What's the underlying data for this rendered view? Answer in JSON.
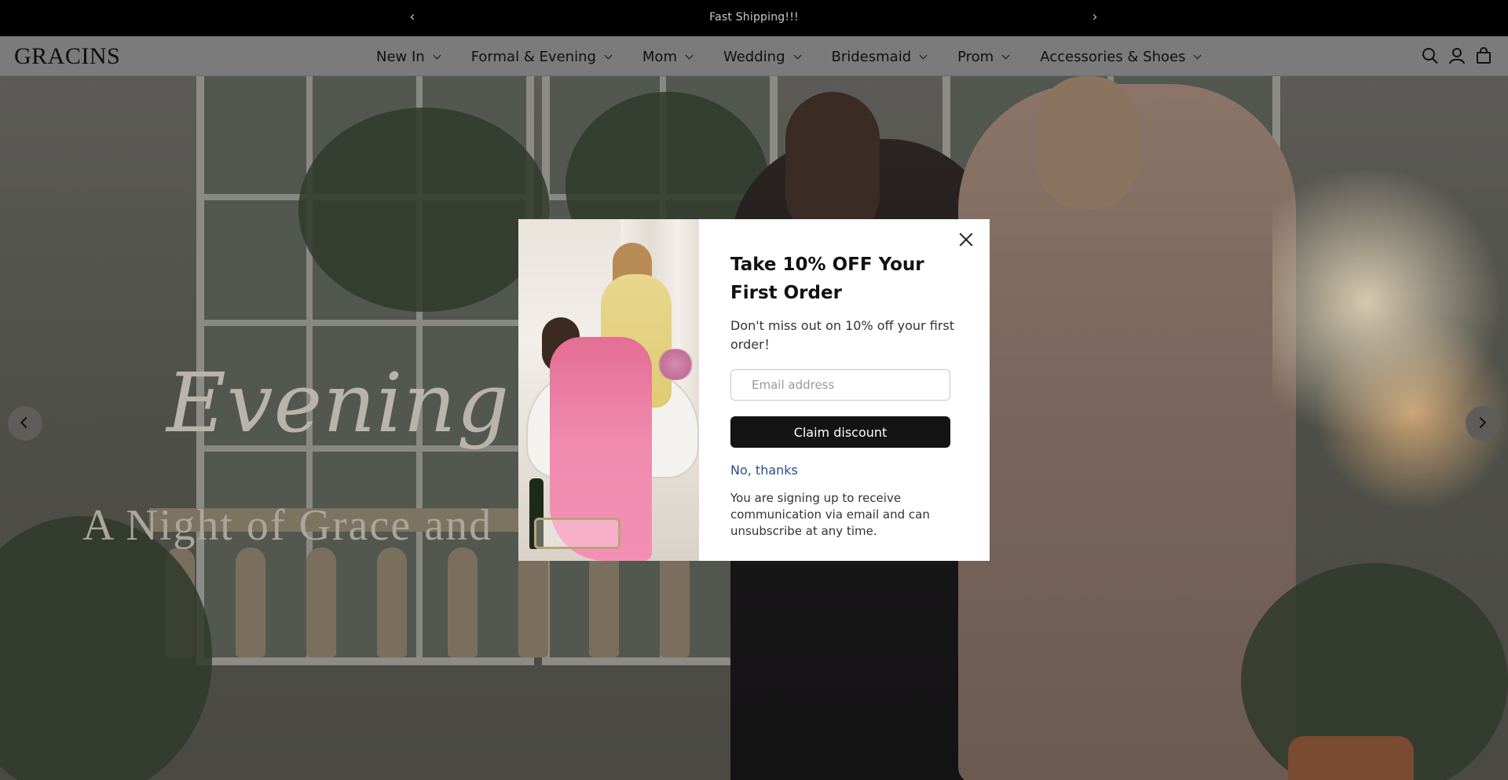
{
  "announcement": {
    "message": "Fast Shipping!!!",
    "prev_glyph": "‹",
    "next_glyph": "›"
  },
  "header": {
    "logo": "GRACINS",
    "nav": [
      {
        "label": "New In"
      },
      {
        "label": "Formal & Evening"
      },
      {
        "label": "Mom"
      },
      {
        "label": "Wedding"
      },
      {
        "label": "Bridesmaid"
      },
      {
        "label": "Prom"
      },
      {
        "label": "Accessories & Shoes"
      }
    ],
    "icons": [
      "search-icon",
      "account-icon",
      "cart-icon"
    ]
  },
  "hero": {
    "title": "Evening Dre",
    "subtitle": "A Night of Grace and"
  },
  "modal": {
    "title": "Take 10% OFF Your First Order",
    "description": "Don't miss out on 10% off your first order！",
    "email_placeholder": "Email address",
    "claim_label": "Claim discount",
    "no_thanks_label": "No, thanks",
    "fine_print": "You are signing up to receive communication via email and can unsubscribe at any time."
  },
  "colors": {
    "announcement_bg": "#000000",
    "header_overlay": "#7b7b7b",
    "button_bg": "#141414",
    "link": "#2b4a8e"
  }
}
